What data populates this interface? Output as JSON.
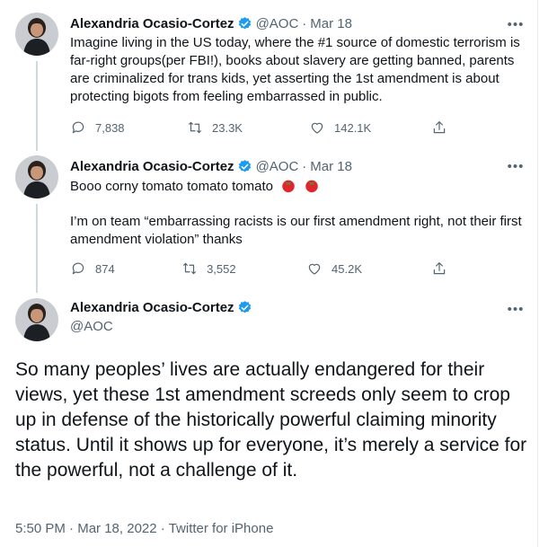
{
  "tweets": [
    {
      "name": "Alexandria Ocasio-Cortez",
      "handle": "@AOC",
      "date": "Mar 18",
      "text": "Imagine living in the US today, where the #1 source of domestic terrorism is far-right groups(per FBI!), books about slavery are getting banned, parents are criminalized for trans kids, yet asserting the 1st amendment is about protecting bigots from feeling embarrassed in public.",
      "replies": "7,838",
      "retweets": "23.3K",
      "likes": "142.1K"
    },
    {
      "name": "Alexandria Ocasio-Cortez",
      "handle": "@AOC",
      "date": "Mar 18",
      "text_line1": "Booo corny tomato tomato tomato",
      "text_emoji": "🍅 🍅",
      "text_para2": "I’m on team “embarrassing racists is our first amendment right, not their first amendment violation” thanks",
      "replies": "874",
      "retweets": "3,552",
      "likes": "45.2K"
    }
  ],
  "main": {
    "name": "Alexandria Ocasio-Cortez",
    "handle": "@AOC",
    "text": "So many peoples’ lives are actually endangered for their views, yet these 1st amendment screeds only seem to crop up in defense of the historically powerful claiming minority status. Until it shows up for everyone, it’s merely a service for the powerful, not a challenge of it.",
    "time": "5:50 PM",
    "date": "Mar 18, 2022",
    "source": "Twitter for iPhone"
  },
  "ui": {
    "separator": "·",
    "more": "•••",
    "accent": "#1d9bf0",
    "muted": "#536471"
  },
  "icons": [
    "verified-badge-icon",
    "reply-icon",
    "retweet-icon",
    "like-icon",
    "share-icon",
    "more-icon",
    "tomato-emoji"
  ]
}
